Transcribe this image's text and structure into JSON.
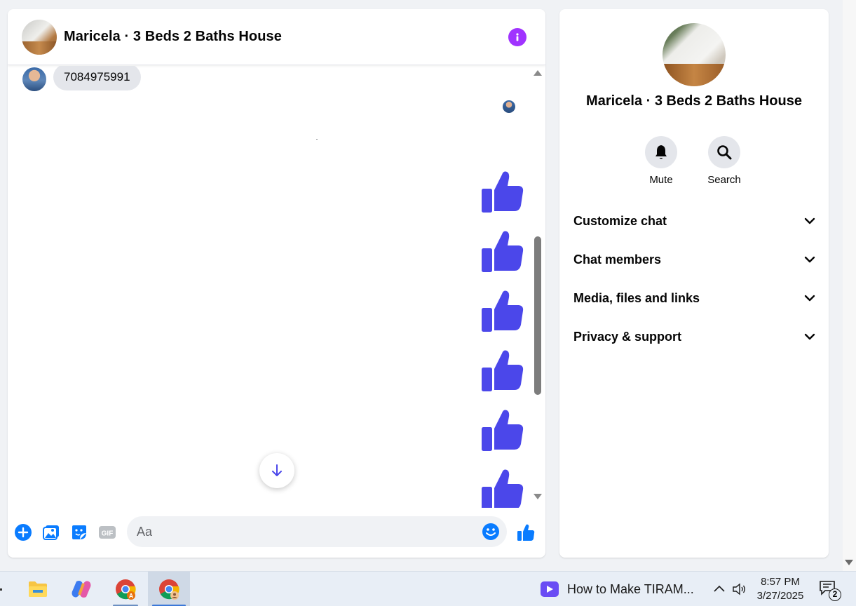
{
  "chat": {
    "title": "Maricela · 3 Beds 2 Baths House",
    "messages": [
      {
        "sender": "other",
        "text": "7084975991"
      }
    ],
    "like_reactions_count": 6,
    "composer": {
      "placeholder": "Aa",
      "icons": [
        "plus-circle-icon",
        "photo-icon",
        "sticker-icon",
        "gif-icon",
        "emoji-icon",
        "like-icon"
      ],
      "gif_label": "GIF"
    },
    "accent_color": "#4b47ea"
  },
  "info_panel": {
    "title": "Maricela · 3 Beds 2 Baths House",
    "actions": [
      {
        "label": "Mute",
        "icon": "bell-icon"
      },
      {
        "label": "Search",
        "icon": "search-icon"
      }
    ],
    "sections": [
      {
        "label": "Customize chat"
      },
      {
        "label": "Chat members"
      },
      {
        "label": "Media, files and links"
      },
      {
        "label": "Privacy & support"
      }
    ]
  },
  "taskbar": {
    "apps": [
      "file-explorer",
      "copilot",
      "chrome-profile-a",
      "chrome-profile-b"
    ],
    "media_title": "How to Make TIRAM...",
    "time": "8:57 PM",
    "date": "3/27/2025",
    "notification_count": "2"
  }
}
